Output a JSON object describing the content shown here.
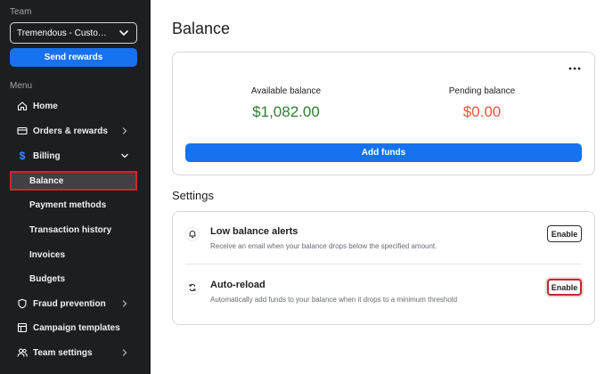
{
  "sidebar": {
    "team_label": "Team",
    "team_select_value": "Tremendous - Customer S...",
    "send_rewards_label": "Send rewards",
    "menu_label": "Menu",
    "items": [
      {
        "label": "Home",
        "icon": "home-icon"
      },
      {
        "label": "Orders & rewards",
        "icon": "card-icon"
      },
      {
        "label": "Billing",
        "icon": "dollar-icon"
      },
      {
        "label": "Fraud prevention",
        "icon": "shield-icon"
      },
      {
        "label": "Campaign templates",
        "icon": "template-icon"
      },
      {
        "label": "Team settings",
        "icon": "users-icon"
      }
    ],
    "billing_sub": [
      {
        "label": "Balance"
      },
      {
        "label": "Payment methods"
      },
      {
        "label": "Transaction history"
      },
      {
        "label": "Invoices"
      },
      {
        "label": "Budgets"
      }
    ]
  },
  "main": {
    "title": "Balance",
    "available_label": "Available balance",
    "available_value": "$1,082.00",
    "pending_label": "Pending balance",
    "pending_value": "$0.00",
    "add_funds_label": "Add funds",
    "settings_title": "Settings",
    "settings": [
      {
        "title": "Low balance alerts",
        "desc": "Receive an email when your balance drops below the specified amount.",
        "button": "Enable",
        "icon": "bell-icon"
      },
      {
        "title": "Auto-reload",
        "desc": "Automatically add funds to your balance when it drops to a minimum threshold",
        "button": "Enable",
        "icon": "refresh-icon"
      }
    ]
  },
  "colors": {
    "brand_blue": "#1672ee",
    "available_green": "#2e7d32",
    "pending_red": "#e8553e",
    "sidebar_bg": "#1d1e20",
    "highlight_red": "#d6232b"
  }
}
